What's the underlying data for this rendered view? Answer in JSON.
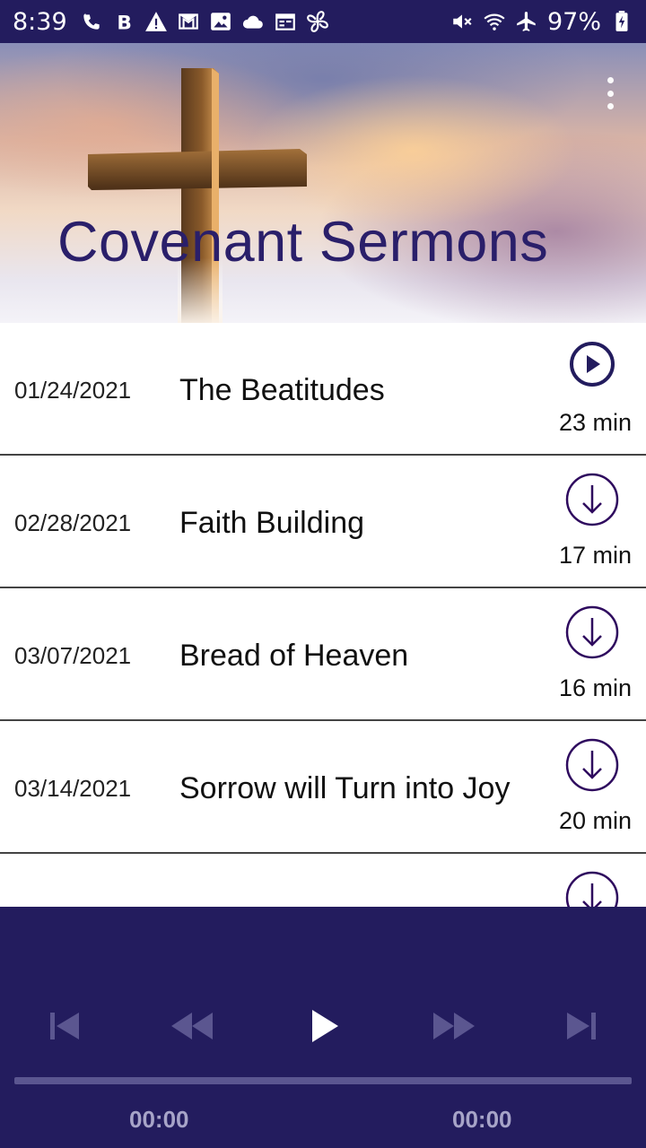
{
  "status_bar": {
    "time": "8:39",
    "left_icons": [
      "wifi-calling-icon",
      "b-app-icon",
      "warning-icon",
      "gmail-icon",
      "image-icon",
      "cloud-icon",
      "calendar-icon",
      "fan-icon"
    ],
    "right_icons": [
      "mute-icon",
      "wifi-icon",
      "airplane-mode-icon",
      "battery-charging-icon"
    ],
    "battery": "97%"
  },
  "header": {
    "title": "Covenant Sermons",
    "menu_icon": "more-vert-icon"
  },
  "sermons": [
    {
      "date": "01/24/2021",
      "title": "The Beatitudes",
      "duration": "23 min",
      "action": "play-circle-icon"
    },
    {
      "date": "02/28/2021",
      "title": "Faith Building",
      "duration": "17 min",
      "action": "download-icon"
    },
    {
      "date": "03/07/2021",
      "title": "Bread of Heaven",
      "duration": "16 min",
      "action": "download-icon"
    },
    {
      "date": "03/14/2021",
      "title": "Sorrow will Turn into Joy",
      "duration": "20 min",
      "action": "download-icon"
    },
    {
      "date": "",
      "title": "",
      "duration": "",
      "action": "download-icon"
    }
  ],
  "player": {
    "controls": [
      "skip-previous-icon",
      "rewind-icon",
      "play-icon",
      "fast-forward-icon",
      "skip-next-icon"
    ],
    "elapsed": "00:00",
    "total": "00:00",
    "progress": 0
  },
  "colors": {
    "primary": "#231c5e",
    "title": "#2a1f6a",
    "icon_accent": "#2e0a5e"
  }
}
